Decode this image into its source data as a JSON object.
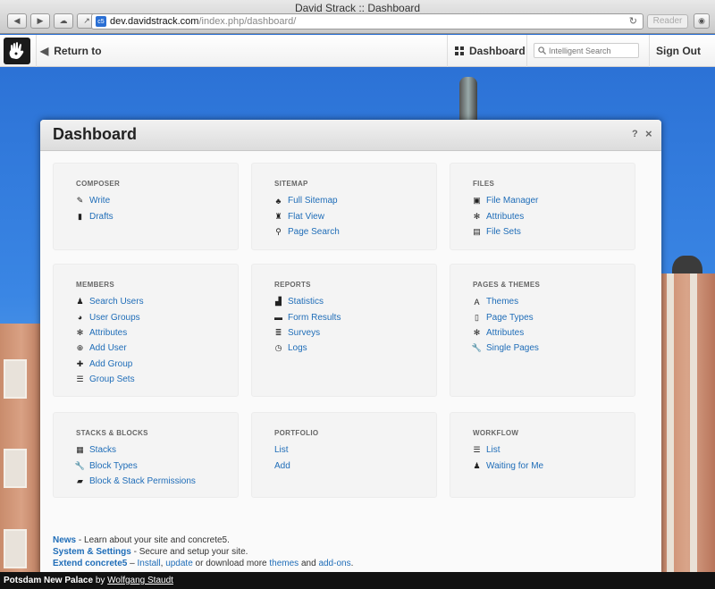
{
  "browser": {
    "window_title": "David Strack :: Dashboard",
    "url_host": "dev.davidstrack.com",
    "url_path": "/index.php/dashboard/",
    "reader_label": "Reader"
  },
  "toolbar": {
    "return_label": "Return to Website",
    "dashboard_label": "Dashboard",
    "search_placeholder": "Intelligent Search",
    "signout_label": "Sign Out"
  },
  "panel": {
    "title": "Dashboard",
    "help": "?",
    "close": "×"
  },
  "sections": [
    {
      "title": "COMPOSER",
      "items": [
        {
          "label": "Write",
          "icon": "pencil-icon"
        },
        {
          "label": "Drafts",
          "icon": "book-icon"
        }
      ]
    },
    {
      "title": "SITEMAP",
      "items": [
        {
          "label": "Full Sitemap",
          "icon": "sitemap-icon"
        },
        {
          "label": "Flat View",
          "icon": "flat-view-icon"
        },
        {
          "label": "Page Search",
          "icon": "search-icon"
        }
      ]
    },
    {
      "title": "FILES",
      "items": [
        {
          "label": "File Manager",
          "icon": "picture-icon"
        },
        {
          "label": "Attributes",
          "icon": "gear-icon"
        },
        {
          "label": "File Sets",
          "icon": "list-alt-icon"
        }
      ]
    },
    {
      "title": "MEMBERS",
      "items": [
        {
          "label": "Search Users",
          "icon": "user-icon"
        },
        {
          "label": "User Groups",
          "icon": "globe-icon"
        },
        {
          "label": "Attributes",
          "icon": "gear-icon"
        },
        {
          "label": "Add User",
          "icon": "plus-circle-icon"
        },
        {
          "label": "Add Group",
          "icon": "plus-icon"
        },
        {
          "label": "Group Sets",
          "icon": "list-icon"
        }
      ]
    },
    {
      "title": "REPORTS",
      "items": [
        {
          "label": "Statistics",
          "icon": "signal-icon"
        },
        {
          "label": "Form Results",
          "icon": "briefcase-icon"
        },
        {
          "label": "Surveys",
          "icon": "tasks-icon"
        },
        {
          "label": "Logs",
          "icon": "clock-icon"
        }
      ]
    },
    {
      "title": "PAGES & THEMES",
      "items": [
        {
          "label": "Themes",
          "icon": "font-icon"
        },
        {
          "label": "Page Types",
          "icon": "file-icon"
        },
        {
          "label": "Attributes",
          "icon": "gear-icon"
        },
        {
          "label": "Single Pages",
          "icon": "wrench-icon"
        }
      ]
    },
    {
      "title": "STACKS & BLOCKS",
      "items": [
        {
          "label": "Stacks",
          "icon": "grid-icon"
        },
        {
          "label": "Block Types",
          "icon": "wrench-icon"
        },
        {
          "label": "Block & Stack Permissions",
          "icon": "lock-icon"
        }
      ]
    },
    {
      "title": "PORTFOLIO",
      "items": [
        {
          "label": "List",
          "icon": ""
        },
        {
          "label": "Add",
          "icon": ""
        }
      ]
    },
    {
      "title": "WORKFLOW",
      "items": [
        {
          "label": "List",
          "icon": "list-icon"
        },
        {
          "label": "Waiting for Me",
          "icon": "user-icon"
        }
      ]
    }
  ],
  "footer": {
    "news_label": "News",
    "news_text": " - Learn about your site and concrete5.",
    "settings_label": "System & Settings",
    "settings_text": " - Secure and setup your site.",
    "extend_label": "Extend concrete5",
    "extend_dash": " – ",
    "install_label": "Install",
    "comma": ",",
    "update_label": "update",
    "or_text": " or download more ",
    "themes_label": "themes",
    "and_text": " and ",
    "addons_label": "add-ons",
    "period": "."
  },
  "caption": {
    "title": "Potsdam New Palace",
    "by": " by ",
    "author": "Wolfgang Staudt"
  },
  "colors": {
    "link": "#1f6db8",
    "sky": "#2c72d6"
  }
}
